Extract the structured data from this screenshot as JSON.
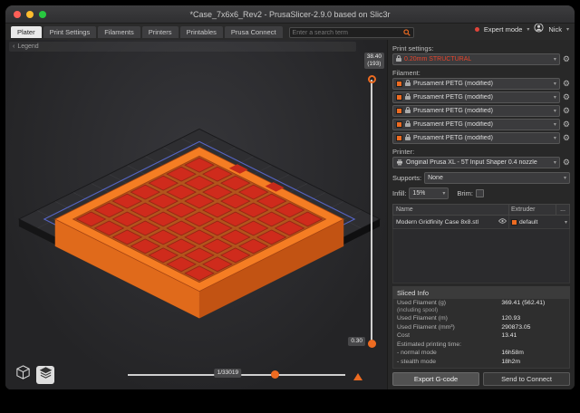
{
  "window": {
    "title": "*Case_7x6x6_Rev2 - PrusaSlicer-2.9.0 based on Slic3r"
  },
  "tabbar": {
    "tabs": [
      "Plater",
      "Print Settings",
      "Filaments",
      "Printers",
      "Printables",
      "Prusa Connect"
    ],
    "search_placeholder": "Enter a search term",
    "mode_label": "Expert mode",
    "user_name": "Nick"
  },
  "viewport": {
    "legend_label": "Legend",
    "legend_caret": "‹",
    "layer_slider": {
      "top_value": "38.40",
      "top_layer": "(193)",
      "bottom_value": "0.30"
    },
    "move_slider": {
      "value": "1/33019"
    }
  },
  "sidebar": {
    "print_settings_label": "Print settings:",
    "print_preset": "0.20mm STRUCTURAL",
    "filament_label": "Filament:",
    "filaments": [
      "Prusament PETG (modified)",
      "Prusament PETG (modified)",
      "Prusament PETG (modified)",
      "Prusament PETG (modified)",
      "Prusament PETG (modified)"
    ],
    "printer_label": "Printer:",
    "printer_preset": "Original Prusa XL - 5T Input Shaper 0.4 nozzle",
    "supports_label": "Supports:",
    "supports_value": "None",
    "infill_label": "Infill:",
    "infill_value": "15%",
    "brim_label": "Brim:",
    "table": {
      "col_name": "Name",
      "col_extruder": "Extruder",
      "menu_button": "...",
      "object_name": "Modern Gridfinity Case 8x8.stl",
      "object_extruder": "default"
    },
    "sliced_info": {
      "title": "Sliced Info",
      "used_g_label": "Used Filament (g)",
      "used_g_sublabel": "(including spool)",
      "used_g_value": "369.41 (562.41)",
      "used_m_label": "Used Filament (m)",
      "used_m_value": "120.93",
      "used_mm3_label": "Used Filament (mm³)",
      "used_mm3_value": "290873.05",
      "cost_label": "Cost",
      "cost_value": "13.41",
      "time_label": "Estimated printing time:",
      "normal_label": "- normal mode",
      "normal_value": "16h58m",
      "stealth_label": "- stealth mode",
      "stealth_value": "18h2m"
    },
    "export_button": "Export G-code",
    "send_button": "Send to Connect"
  },
  "colors": {
    "accent_orange": "#ED6B21",
    "preset_modified_red": "#E8452C",
    "model_orange": "#F57D23",
    "infill_red": "#CF2B1C",
    "traffic_close": "#FF5F57",
    "traffic_minimize": "#FEBC2E",
    "traffic_zoom": "#28C840"
  }
}
